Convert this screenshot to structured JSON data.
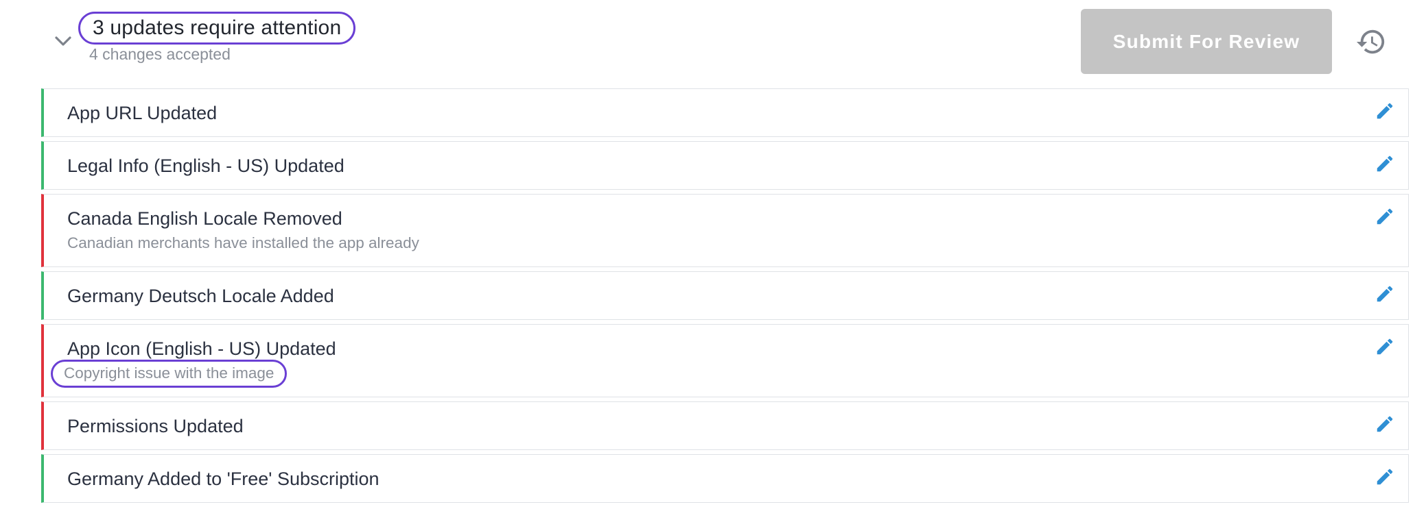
{
  "header": {
    "title": "3 updates require attention",
    "subtitle": "4 changes accepted",
    "submit_label": "Submit For Review",
    "icons": {
      "collapse": "chevron-down-icon",
      "history": "history-icon"
    }
  },
  "changes": [
    {
      "title": "App URL Updated",
      "note": "",
      "status": "accepted"
    },
    {
      "title": "Legal Info (English - US) Updated",
      "note": "",
      "status": "accepted"
    },
    {
      "title": "Canada English Locale Removed",
      "note": "Canadian merchants have installed the app already",
      "status": "rejected"
    },
    {
      "title": "Germany Deutsch Locale Added",
      "note": "",
      "status": "accepted"
    },
    {
      "title": "App Icon (English - US) Updated",
      "note": "Copyright issue with the image",
      "status": "rejected"
    },
    {
      "title": "Permissions Updated",
      "note": "",
      "status": "rejected"
    },
    {
      "title": "Germany Added to 'Free' Subscription",
      "note": "",
      "status": "accepted"
    }
  ],
  "colors": {
    "accepted": "#3cb86f",
    "rejected": "#e0323c",
    "edit_icon": "#2f8fd4",
    "annotation": "#6a3fd4",
    "submit_disabled": "#c4c4c4"
  }
}
